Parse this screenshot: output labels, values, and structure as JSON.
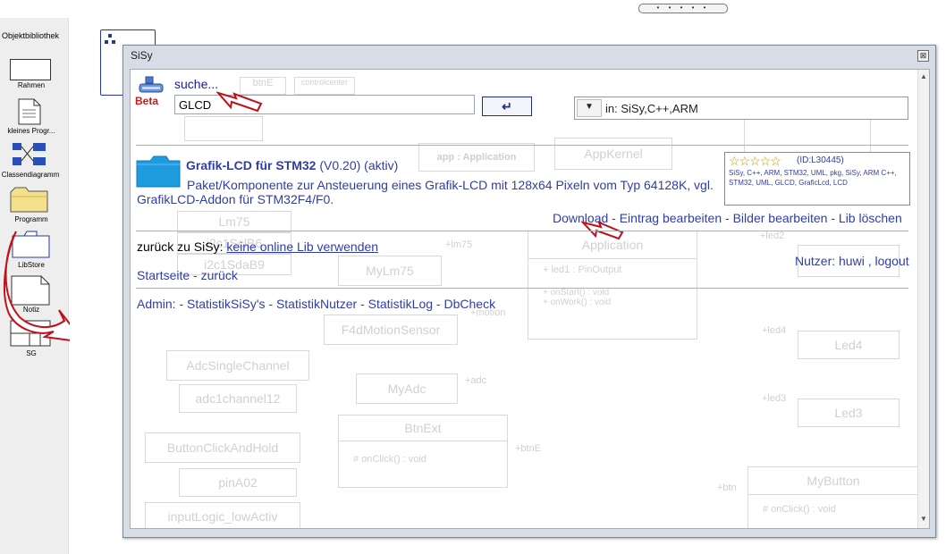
{
  "page": {
    "topbar_dots": "• • • • •"
  },
  "library": {
    "title": "Objektbibliothek",
    "items": [
      {
        "name": "rahmen",
        "label": "Rahmen"
      },
      {
        "name": "kleines-programm",
        "label": "kleines Progr..."
      },
      {
        "name": "klassendiagramm",
        "label": "Classendiagramm"
      },
      {
        "name": "programm",
        "label": "Programm"
      },
      {
        "name": "libstore",
        "label": "LibStore"
      },
      {
        "name": "notiz",
        "label": "Notiz"
      },
      {
        "name": "sg",
        "label": "SG"
      }
    ]
  },
  "dialog": {
    "title": "SiSy",
    "close_glyph": "⊠",
    "search": {
      "label": "suche...",
      "beta": "Beta",
      "value": "GLCD",
      "enter_glyph": "↵",
      "scope_label": "in: SiSy,C++,ARM"
    },
    "result": {
      "title": "Grafik-LCD für STM32",
      "version": "(V0.20)",
      "status": "(aktiv)",
      "description": "Paket/Komponente zur Ansteuerung eines Grafik-LCD mit 128x64 Pixeln vom Typ 64128K, vgl. GrafikLCD-Addon für STM32F4/F0.",
      "stars": "☆☆☆☆☆",
      "rating": 0,
      "id": "(ID:L30445)",
      "tags": "SiSy, C++, ARM, STM32, UML, pkg, SiSy, ARM C++, STM32, UML, GLCD, GraficLcd, LCD",
      "actions": {
        "download": "Download",
        "sep": " - ",
        "edit": "Eintrag bearbeiten",
        "images": "Bilder bearbeiten",
        "delete": "Lib löschen"
      }
    },
    "nav": {
      "back_prefix": "zurück zu SiSy: ",
      "no_online_lib": "keine online Lib verwenden",
      "user_prefix": "Nutzer: ",
      "user": "huwi",
      "user_sep": " , ",
      "logout": "logout",
      "start": "Startseite",
      "nav_sep": " - ",
      "back": "zurück"
    },
    "admin": {
      "label": "Admin: - ",
      "stat_sisy": "StatistikSiSy's",
      "stat_user": "StatistikNutzer",
      "stat_log": "StatistikLog",
      "dbcheck": "DbCheck",
      "sep": " - "
    }
  },
  "background_diagram": {
    "btnE": "btnE",
    "controlcenter": "controlcenter",
    "application": "app : Application",
    "appkernel": "AppKernel",
    "application2": "Application",
    "lm75": "Lm75",
    "i2c1sclb6": "i2c1SclB6",
    "i2c1sdab9": "i2c1SdaB9",
    "mylm75": "MyLm75",
    "led1": "+ led1 : PinOutput",
    "onstart": "+ onStart() : void",
    "onwork": "+ onWork() : void",
    "led2": "+led2",
    "f4d": "F4dMotionSensor",
    "adcsingle": "AdcSingleChannel",
    "adc1ch12": "adc1channel12",
    "myadc": "MyAdc",
    "led4": "Led4",
    "led3": "Led3",
    "btnext": "BtnExt",
    "onclick": "# onClick() : void",
    "buttonclick": "ButtonClickAndHold",
    "pina02": "pinA02",
    "inputlogic": "inputLogic_lowActiv",
    "mybutton": "MyButton",
    "onclick2": "# onClick() : void",
    "led1label": "+led1",
    "led4label": "+led4",
    "led3label": "+led3",
    "btnlabel": "+btn",
    "btnelabel": "+btnE",
    "adclabel": "+adc",
    "motionlabel": "+motion",
    "lm75label": "+lm75"
  }
}
